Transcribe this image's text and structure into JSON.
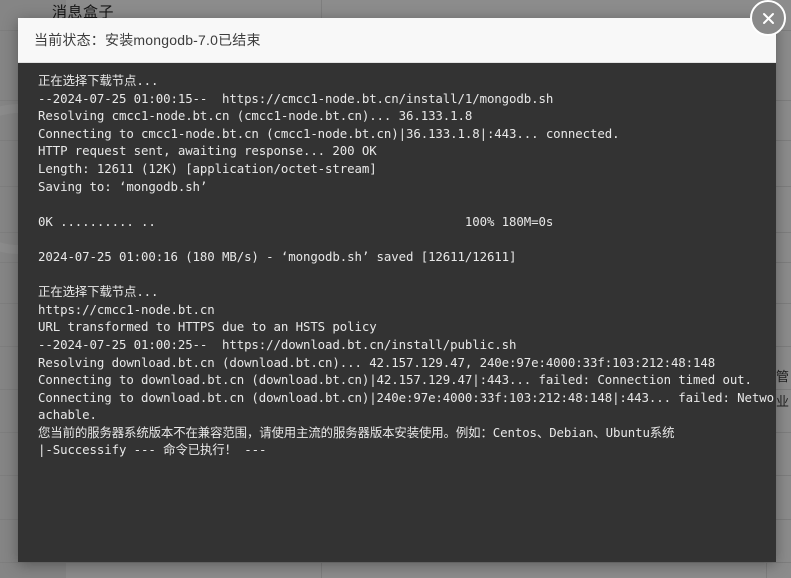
{
  "background": {
    "page_title": "消息盒子",
    "right_column_texts": [
      "管",
      "业"
    ]
  },
  "dialog": {
    "header": {
      "title": "当前状态：安装mongodb-7.0已结束",
      "close_icon": "close-circle-icon"
    },
    "terminal": {
      "lines": [
        "正在选择下载节点...",
        "--2024-07-25 01:00:15--  https://cmcc1-node.bt.cn/install/1/mongodb.sh",
        "Resolving cmcc1-node.bt.cn (cmcc1-node.bt.cn)... 36.133.1.8",
        "Connecting to cmcc1-node.bt.cn (cmcc1-node.bt.cn)|36.133.1.8|:443... connected.",
        "HTTP request sent, awaiting response... 200 OK",
        "Length: 12611 (12K) [application/octet-stream]",
        "Saving to: ‘mongodb.sh’",
        "",
        "0K .......... ..                                          100% 180M=0s",
        "",
        "2024-07-25 01:00:16 (180 MB/s) - ‘mongodb.sh’ saved [12611/12611]",
        "",
        "正在选择下载节点...",
        "https://cmcc1-node.bt.cn",
        "URL transformed to HTTPS due to an HSTS policy",
        "--2024-07-25 01:00:25--  https://download.bt.cn/install/public.sh",
        "Resolving download.bt.cn (download.bt.cn)... 42.157.129.47, 240e:97e:4000:33f:103:212:48:148",
        "Connecting to download.bt.cn (download.bt.cn)|42.157.129.47|:443... failed: Connection timed out.",
        "Connecting to download.bt.cn (download.bt.cn)|240e:97e:4000:33f:103:212:48:148|:443... failed: Network is unre",
        "achable.",
        "您当前的服务器系统版本不在兼容范围，请使用主流的服务器版本安装使用。例如：Centos、Debian、Ubuntu系统",
        "|-Successify --- 命令已执行！ ---"
      ]
    }
  }
}
